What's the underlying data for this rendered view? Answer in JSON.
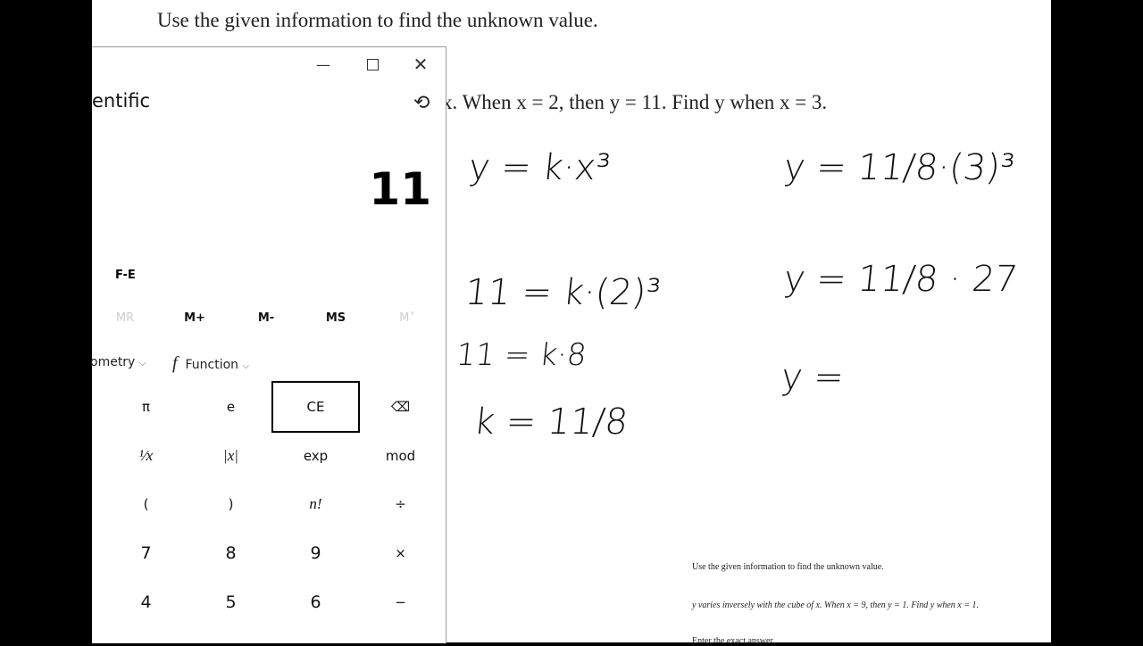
{
  "page": {
    "heading": "Use the given information to find the unknown value.",
    "problem_visible": "x. When x = 2, then y = 11. Find y when x = 3.",
    "thumbnail": {
      "heading": "Use the given information to find the unknown value.",
      "problem": "y varies inversely with the cube of x. When x = 9, then y = 1. Find y when x = 1.",
      "prompt": "Enter the exact answer."
    }
  },
  "handwriting": {
    "left": [
      "y = k·x³",
      "11 = k·(2)³",
      "11 = k·8",
      "k = 11/8"
    ],
    "right": [
      "y = 11/8·(3)³",
      "y = 11/8 · 27",
      "y ="
    ]
  },
  "calculator": {
    "title": "entific",
    "display": "11",
    "fe_label": "F-E",
    "memory": [
      "MR",
      "M+",
      "M-",
      "MS",
      "M˅"
    ],
    "trig_label": "ometry",
    "function_label": "Function",
    "keys": [
      [
        "π",
        "e",
        "CE",
        "⌫"
      ],
      [
        "¹⁄x",
        "|x|",
        "exp",
        "mod"
      ],
      [
        "(",
        ")",
        "n!",
        "÷"
      ],
      [
        "7",
        "8",
        "9",
        "×"
      ],
      [
        "4",
        "5",
        "6",
        "−"
      ]
    ]
  }
}
